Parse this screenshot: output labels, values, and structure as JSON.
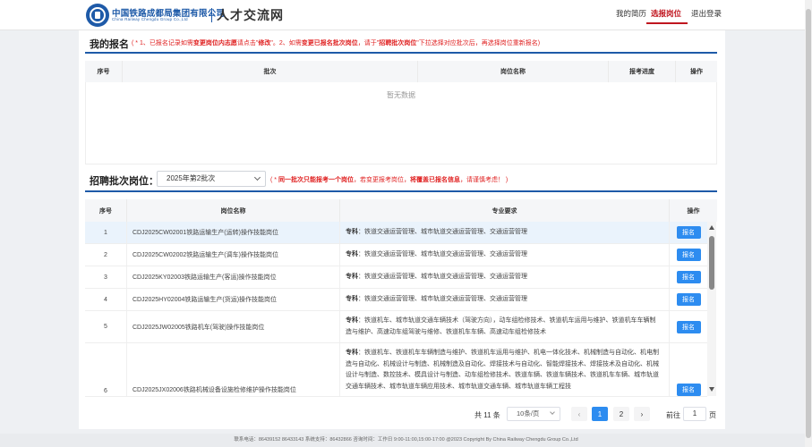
{
  "header": {
    "logo_cn": "中国铁路成都局集团有限公司",
    "logo_en": "China Railway Chengdu Group Co.,Ltd",
    "site_title": "人才交流网",
    "nav": [
      {
        "label": "我的简历"
      },
      {
        "label": "选报岗位"
      },
      {
        "label": "退出登录"
      }
    ]
  },
  "my_apply": {
    "title": "我的报名",
    "note_parts": [
      "( * 1、已报名记录如需",
      "变更岗位内志愿",
      "请点击\"",
      "修改",
      "\"。2、如需",
      "变更已报名批次岗位",
      "，请于\"",
      "招聘批次岗位",
      "\"下拉选择对应批次后，再选择岗位重新报名)"
    ],
    "columns": [
      "序号",
      "批次",
      "岗位名称",
      "报考进度",
      "操作"
    ],
    "empty_text": "暂无数据"
  },
  "batch": {
    "title": "招聘批次岗位：",
    "selected": "2025年第2批次",
    "note_parts": [
      "( * ",
      "同一批次只能报考一个岗位",
      "，若变更报考岗位，",
      "将覆盖已报名信息",
      "，请谨慎考虑！ )"
    ],
    "columns": [
      "序号",
      "岗位名称",
      "专业要求",
      "操作"
    ],
    "apply_label": "报名",
    "rows": [
      {
        "idx": "1",
        "name": "CDJ2025CW02001铁路运输生产(运转)操作技能岗位",
        "req_label": "专科",
        "req": "：铁道交通运营管理、城市轨道交通运营管理、交通运营管理"
      },
      {
        "idx": "2",
        "name": "CDJ2025CW02002铁路运输生产(调车)操作技能岗位",
        "req_label": "专科",
        "req": "：铁道交通运营管理、城市轨道交通运营管理、交通运营管理"
      },
      {
        "idx": "3",
        "name": "CDJ2025KY02003铁路运输生产(客运)操作技能岗位",
        "req_label": "专科",
        "req": "：铁道交通运营管理、城市轨道交通运营管理、交通运营管理"
      },
      {
        "idx": "4",
        "name": "CDJ2025HY02004铁路运输生产(货运)操作技能岗位",
        "req_label": "专科",
        "req": "：铁道交通运营管理、城市轨道交通运营管理、交通运营管理"
      },
      {
        "idx": "5",
        "name": "CDJ2025JW02005铁路机车(驾驶)操作技能岗位",
        "req_label": "专科",
        "req": "：铁道机车、城市轨道交通车辆技术（驾驶方向），动车组检修技术、铁道机车运用与维护、铁道机车车辆制造与维护、高速动车组驾驶与维修、铁道机车车辆、高速动车组检修技术"
      },
      {
        "idx": "6",
        "name": "CDJ2025JX02006铁路机械设备设施检修维护操作技能岗位",
        "req_label": "专科",
        "req": "：铁道机车、铁道机车车辆制造与维护、铁道机车运用与维护、机电一体化技术、机械制造与自动化、机电制造与自动化、机械设计与制造、机械制造及自动化、焊接技术与自动化、智能焊接技术、焊接技术及自动化、机械设计与制造、数控技术、模具设计与制造、动车组检修技术、铁道车辆、铁道车辆技术、铁道机车车辆、城市轨道交通车辆技术、城市轨道车辆应用技术、城市轨道交通车辆、城市轨道车辆工程技"
      }
    ]
  },
  "pagination": {
    "total": "共 11 条",
    "page_size": "10条/页",
    "pages": [
      "1",
      "2"
    ],
    "goto_label": "前往",
    "goto_value": "1",
    "page_label": "页"
  },
  "footer": {
    "text": "联系电话：86439152  86433143  系统支持：86432866  咨询时间：工作日 9:00-11:00,15:00-17:00  @2023 Copyright By China Railway Chengdu Group Co.,Ltd"
  },
  "colors": {
    "brand_blue": "#1e5aa8",
    "accent_red": "#c0161f",
    "button_blue": "#2d8cf0"
  }
}
